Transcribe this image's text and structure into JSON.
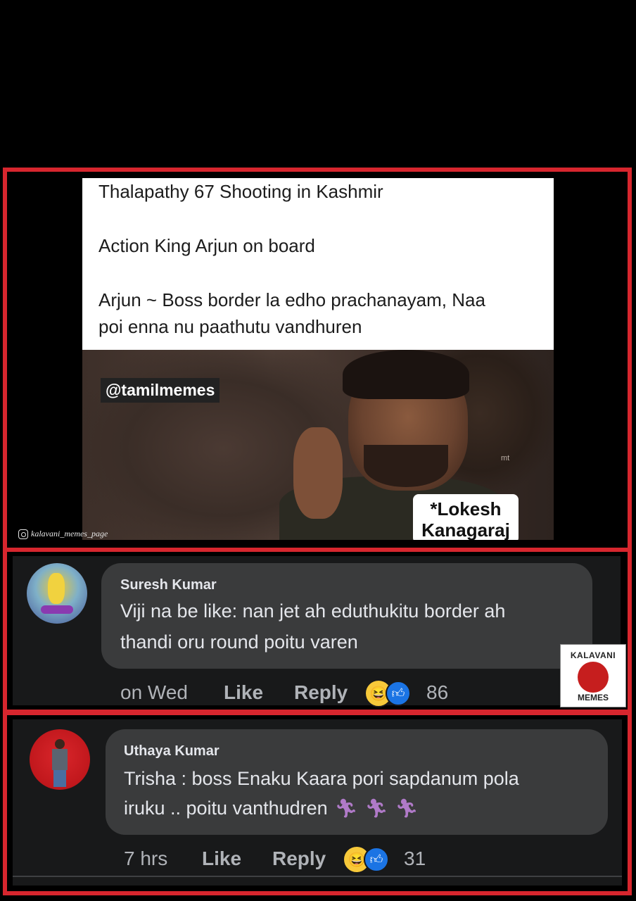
{
  "meme": {
    "line1": "Thalapathy 67 Shooting in Kashmir",
    "line2": "Action King Arjun on board",
    "line3": "Arjun ~ Boss border la edho prachanayam, Naa",
    "line4": "poi enna nu paathutu vandhuren",
    "watermark": "@tamilmemes",
    "small_mark": "mt",
    "label_line1": "*Lokesh",
    "label_line2": "Kanagaraj",
    "instagram_handle": "kalavani_memes_page"
  },
  "comments": [
    {
      "author": "Suresh Kumar",
      "text_line1": "Viji na be like: nan jet ah eduthukitu border ah",
      "text_line2": "thandi oru round poitu varen",
      "time": "on Wed",
      "like_label": "Like",
      "reply_label": "Reply",
      "reaction_count": "86",
      "reactions": [
        "haha-icon",
        "like-icon"
      ]
    },
    {
      "author": "Uthaya Kumar",
      "text_line1": "Trisha : boss Enaku Kaara pori sapdanum pola",
      "text_line2": "iruku .. poitu vanthudren",
      "emoji": [
        "running-person-icon",
        "running-person-icon",
        "running-person-icon"
      ],
      "time": "7 hrs",
      "like_label": "Like",
      "reply_label": "Reply",
      "reaction_count": "31",
      "reactions": [
        "haha-icon",
        "like-icon"
      ]
    }
  ],
  "logo": {
    "top": "KALAVANI",
    "bottom": "MEMES"
  },
  "colors": {
    "frame": "#d7262e",
    "comment_bg": "#18191a",
    "bubble": "#3a3b3c",
    "like_blue": "#1b74e4"
  }
}
